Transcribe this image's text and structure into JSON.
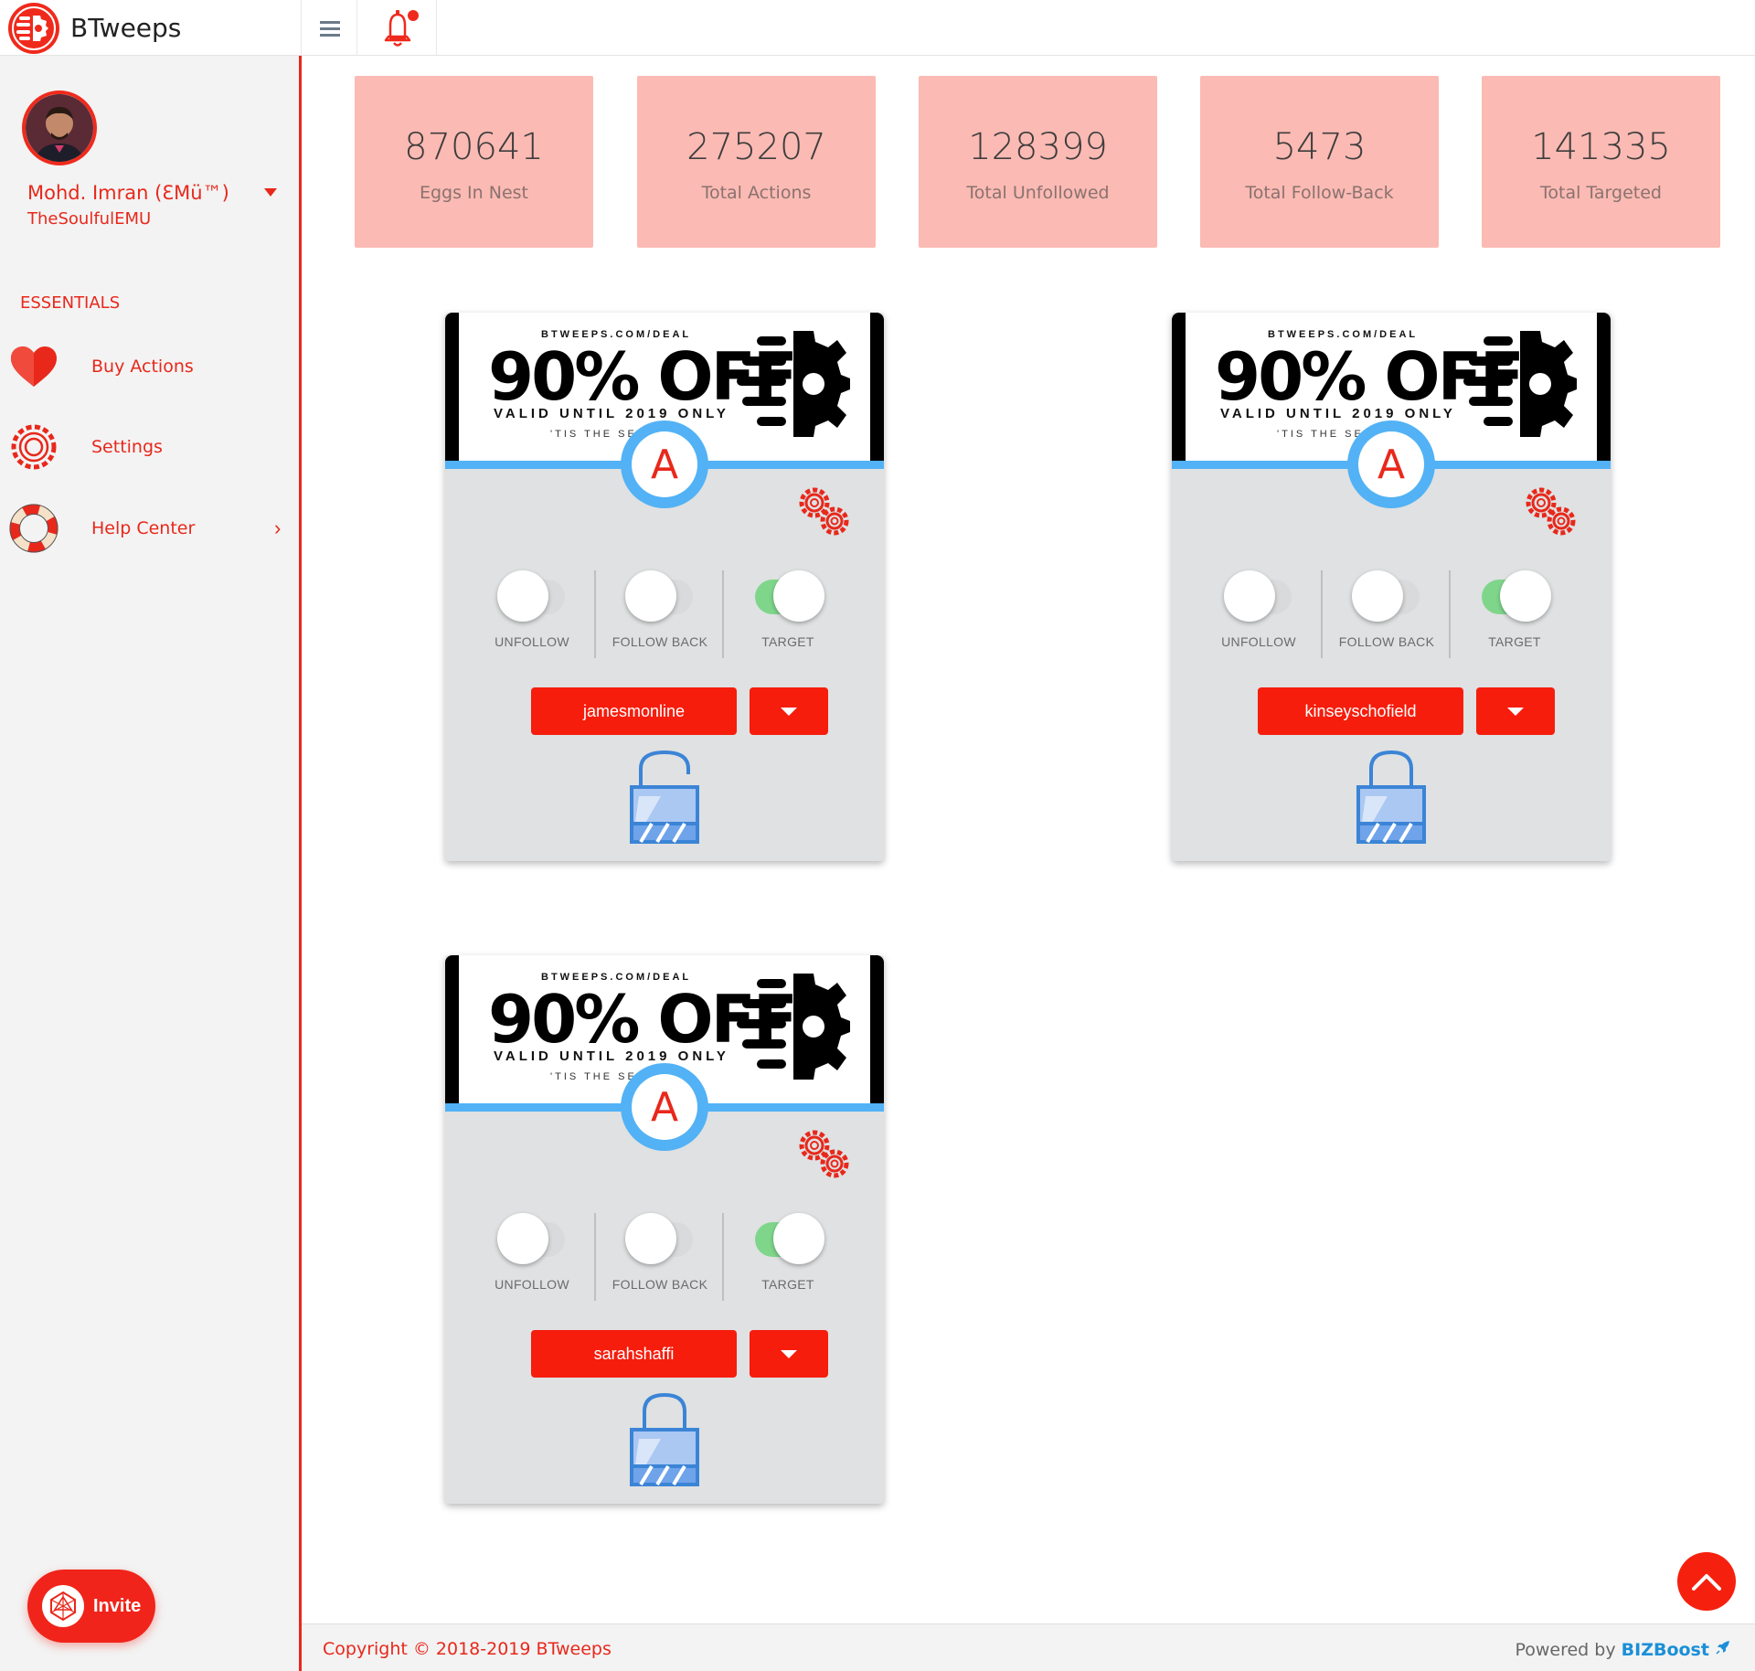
{
  "app": {
    "name": "BTweeps",
    "accent": "#e8281b"
  },
  "header": {
    "menu_icon": "hamburger-icon",
    "notifications_icon": "bell-icon"
  },
  "sidebar": {
    "user_name": "Mohd. Imran (ƐMü™)",
    "user_handle": "TheSoulfulEMU",
    "section_label": "ESSENTIALS",
    "items": [
      {
        "label": "Buy Actions",
        "icon": "heart-icon"
      },
      {
        "label": "Settings",
        "icon": "gear-icon"
      },
      {
        "label": "Help Center",
        "icon": "lifebuoy-icon"
      }
    ],
    "invite_label": "Invite"
  },
  "stats": [
    {
      "value": "870641",
      "label": "Eggs In Nest"
    },
    {
      "value": "275207",
      "label": "Total Actions"
    },
    {
      "value": "128399",
      "label": "Total Unfollowed"
    },
    {
      "value": "5473",
      "label": "Total Follow-Back"
    },
    {
      "value": "141335",
      "label": "Total Targeted"
    }
  ],
  "banner": {
    "url": "BTWEEPS.COM/DEAL",
    "offer": "90% OFF",
    "valid": "VALID UNTIL 2019 ONLY",
    "season": "'TIS THE SEASON",
    "badge_letter": "A"
  },
  "toggle_labels": {
    "unfollow": "UNFOLLOW",
    "follow_back": "FOLLOW BACK",
    "target": "TARGET"
  },
  "accounts": [
    {
      "username": "jamesmonline",
      "unfollow": false,
      "follow_back": false,
      "target": true,
      "lock": "unlocked"
    },
    {
      "username": "kinseyschofield",
      "unfollow": false,
      "follow_back": false,
      "target": true,
      "lock": "locked"
    },
    {
      "username": "sarahshaffi",
      "unfollow": false,
      "follow_back": false,
      "target": true,
      "lock": "locked"
    }
  ],
  "footer": {
    "copyright": "Copyright © 2018-2019 BTweeps",
    "powered_by": "Powered by",
    "powered_brand": "BIZBoost"
  }
}
